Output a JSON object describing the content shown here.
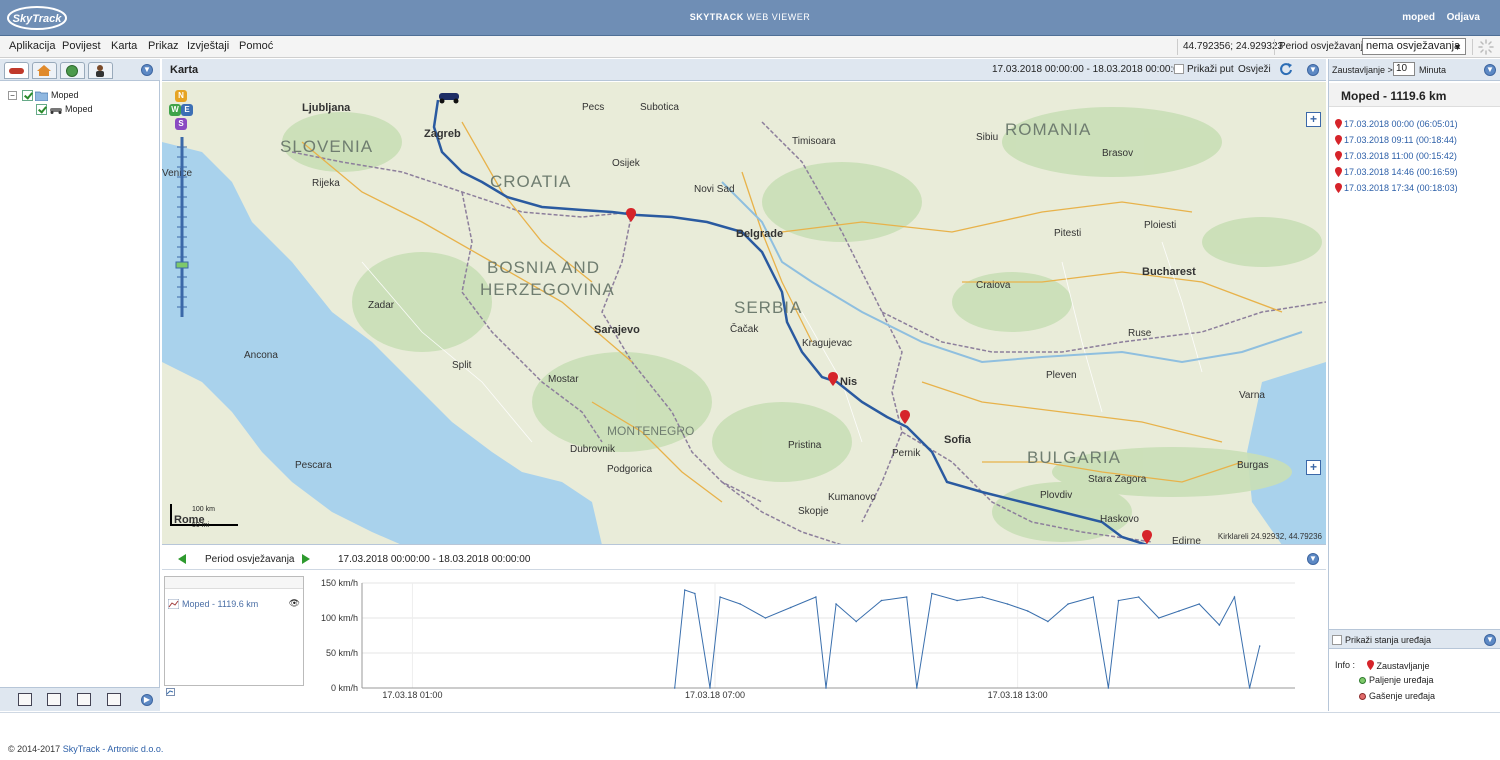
{
  "header": {
    "title_bold": "SKYTRACK",
    "title_thin": "WEB VIEWER",
    "logo_text": "SkyTrack",
    "user": "moped",
    "logout": "Odjava"
  },
  "menu": {
    "items": [
      "Aplikacija",
      "Povijest",
      "Karta",
      "Prikaz",
      "Izvještaji",
      "Pomoć"
    ],
    "coords": "44.792356; 24.929323",
    "refresh_label": "Period osvježavanja",
    "refresh_value": "nema osvježavanja"
  },
  "tree": {
    "root_label": "Moped",
    "child_label": "Moped"
  },
  "map_header": {
    "title": "Karta",
    "period": "17.03.2018 00:00:00 - 18.03.2018 00:00:00",
    "show_route": "Prikaži put",
    "refresh": "Osvježi"
  },
  "map": {
    "countries": [
      "SLOVENIA",
      "CROATIA",
      "BOSNIA AND",
      "HERZEGOVINA",
      "SERBIA",
      "ROMANIA",
      "BULGARIA",
      "MONTENEGRO"
    ],
    "cities": {
      "zagreb": "Zagreb",
      "ljubljana": "Ljubljana",
      "belgrade": "Belgrade",
      "sofia": "Sofia",
      "bucharest": "Bucharest",
      "sarajevo": "Sarajevo",
      "nis": "Nis",
      "timisoara": "Timisoara",
      "novisad": "Novi Sad",
      "split": "Split",
      "rijeka": "Rijeka",
      "skopje": "Skopje",
      "plovdiv": "Plovdiv",
      "craiova": "Craiova",
      "pristina": "Pristina",
      "podgorica": "Podgorica",
      "varna": "Varna",
      "burgas": "Burgas",
      "ancona": "Ancona",
      "pescara": "Pescara",
      "venice": "Venice",
      "rome": "Rome",
      "osijek": "Osijek",
      "brasov": "Brasov",
      "pitesti": "Pitesti",
      "ploiesti": "Ploiesti",
      "ruse": "Ruse",
      "pleven": "Pleven",
      "kragujevac": "Kragujevac",
      "cacak": "Čačak",
      "mostar": "Mostar",
      "zadar": "Zadar",
      "dubrovnik": "Dubrovnik",
      "kumanovo": "Kumanovo",
      "pernik": "Pernik",
      "stara_zagora": "Stara Zagora",
      "haskovo": "Haskovo",
      "edirne": "Edirne",
      "sibiu": "Sibiu",
      "subotica": "Subotica",
      "pecs": "Pecs"
    },
    "scale_km": "100 km",
    "scale_mi": "50 mi",
    "coords": "Kirklareli 24.92932, 44.79236"
  },
  "period_bar": {
    "label": "Period osvježavanja",
    "range": "17.03.2018 00:00:00 - 18.03.2018 00:00:00"
  },
  "chart_data": {
    "type": "line",
    "series": [
      {
        "name": "Moped - 1119.6 km",
        "color": "#3a6fad"
      }
    ],
    "y_ticks": [
      "150 km/h",
      "100 km/h",
      "50 km/h",
      "0 km/h"
    ],
    "ylim": [
      0,
      150
    ],
    "x_ticks": [
      "17.03.18 01:00",
      "17.03.18 07:00",
      "17.03.18 13:00"
    ],
    "x": [
      6.2,
      6.4,
      6.6,
      6.9,
      7.1,
      7.5,
      8.0,
      8.5,
      9.0,
      9.2,
      9.4,
      9.8,
      10.3,
      10.8,
      11.0,
      11.3,
      11.8,
      12.3,
      12.8,
      13.2,
      13.6,
      14.0,
      14.5,
      14.8,
      15.0,
      15.4,
      15.8,
      16.2,
      16.6,
      17.0,
      17.3,
      17.6,
      17.8
    ],
    "values": [
      0,
      140,
      135,
      0,
      130,
      120,
      100,
      115,
      130,
      0,
      120,
      95,
      125,
      130,
      0,
      135,
      125,
      130,
      120,
      110,
      95,
      120,
      130,
      0,
      125,
      130,
      100,
      110,
      120,
      90,
      130,
      0,
      60
    ]
  },
  "right_panel": {
    "stop_label": "Zaustavljanje >",
    "stop_value": "10",
    "stop_unit": "Minuta",
    "title": "Moped - 1119.6 km",
    "stops": [
      "17.03.2018 00:00 (06:05:01)",
      "17.03.2018 09:11 (00:18:44)",
      "17.03.2018 11:00 (00:15:42)",
      "17.03.2018 14:46 (00:16:59)",
      "17.03.2018 17:34 (00:18:03)"
    ],
    "show_states": "Prikaži stanja uređaja",
    "info_label": "Info :",
    "legend_stop": "Zaustavljanje",
    "legend_on": "Paljenje uređaja",
    "legend_off": "Gašenje uređaja"
  },
  "footer": {
    "copy": "© 2014-2017 ",
    "link": "SkyTrack - Artronic d.o.o."
  }
}
